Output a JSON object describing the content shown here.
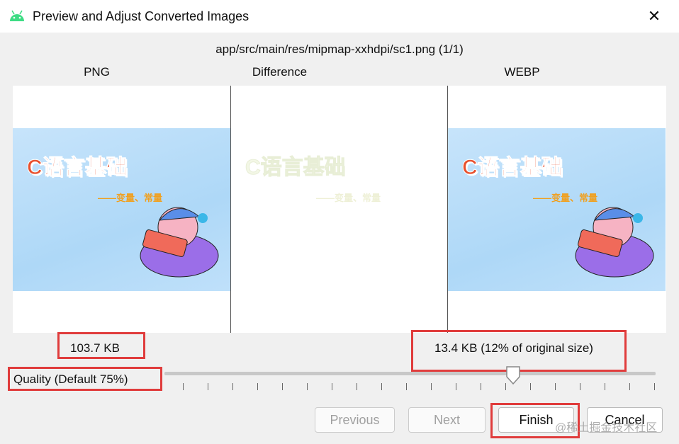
{
  "window": {
    "title": "Preview and Adjust Converted Images",
    "close_icon": "close-icon",
    "app_icon": "android-icon"
  },
  "file_path": "app/src/main/res/mipmap-xxhdpi/sc1.png (1/1)",
  "columns": {
    "png": "PNG",
    "difference": "Difference",
    "webp": "WEBP"
  },
  "image_text": {
    "title": "C语言基础",
    "subtitle": "——变量、常量"
  },
  "png_size": "103.7 KB",
  "webp_size": "13.4 KB (12% of original size)",
  "quality": {
    "label": "Quality (Default 75%)",
    "value": 75,
    "min": 0,
    "max": 100
  },
  "buttons": {
    "previous": "Previous",
    "next": "Next",
    "finish": "Finish",
    "cancel": "Cancel"
  },
  "watermark": "@稀土掘金技术社区",
  "colors": {
    "highlight": "#e03c3c",
    "android": "#3ddc84"
  }
}
